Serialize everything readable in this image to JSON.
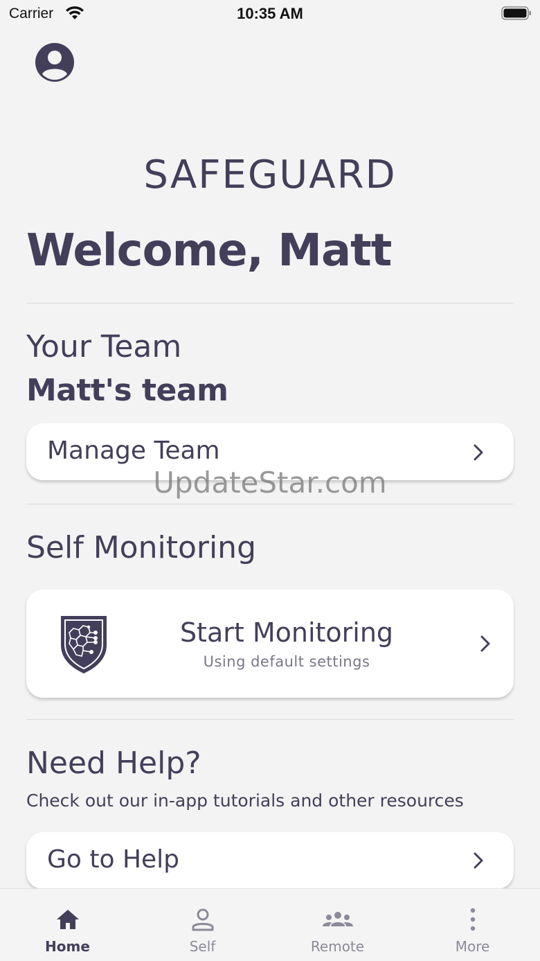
{
  "status_bar": {
    "carrier": "Carrier",
    "time": "10:35 AM",
    "wifi_icon": "wifi-icon",
    "battery_icon": "battery-icon"
  },
  "header": {
    "avatar_icon": "account-circle-icon",
    "brand": "SAFEGUARD",
    "welcome": "Welcome, Matt"
  },
  "team": {
    "section_title": "Your Team",
    "team_name": "Matt's team",
    "manage_label": "Manage Team"
  },
  "self_monitoring": {
    "section_title": "Self Monitoring",
    "start_title": "Start Monitoring",
    "start_subtitle": "Using default settings",
    "icon": "shield-network-icon"
  },
  "help": {
    "section_title": "Need Help?",
    "description": "Check out our in-app tutorials and other resources",
    "go_label": "Go to Help"
  },
  "watermark": "UpdateStar.com",
  "tab_bar": {
    "active": "Home",
    "tabs": [
      {
        "label": "Home",
        "icon": "home-icon"
      },
      {
        "label": "Self",
        "icon": "person-icon"
      },
      {
        "label": "Remote",
        "icon": "group-icon"
      },
      {
        "label": "More",
        "icon": "more-vertical-icon"
      }
    ]
  },
  "colors": {
    "primary_text": "#433f5a",
    "background": "#f3f3f3",
    "card": "#ffffff",
    "inactive_tab": "#8c8a99"
  }
}
